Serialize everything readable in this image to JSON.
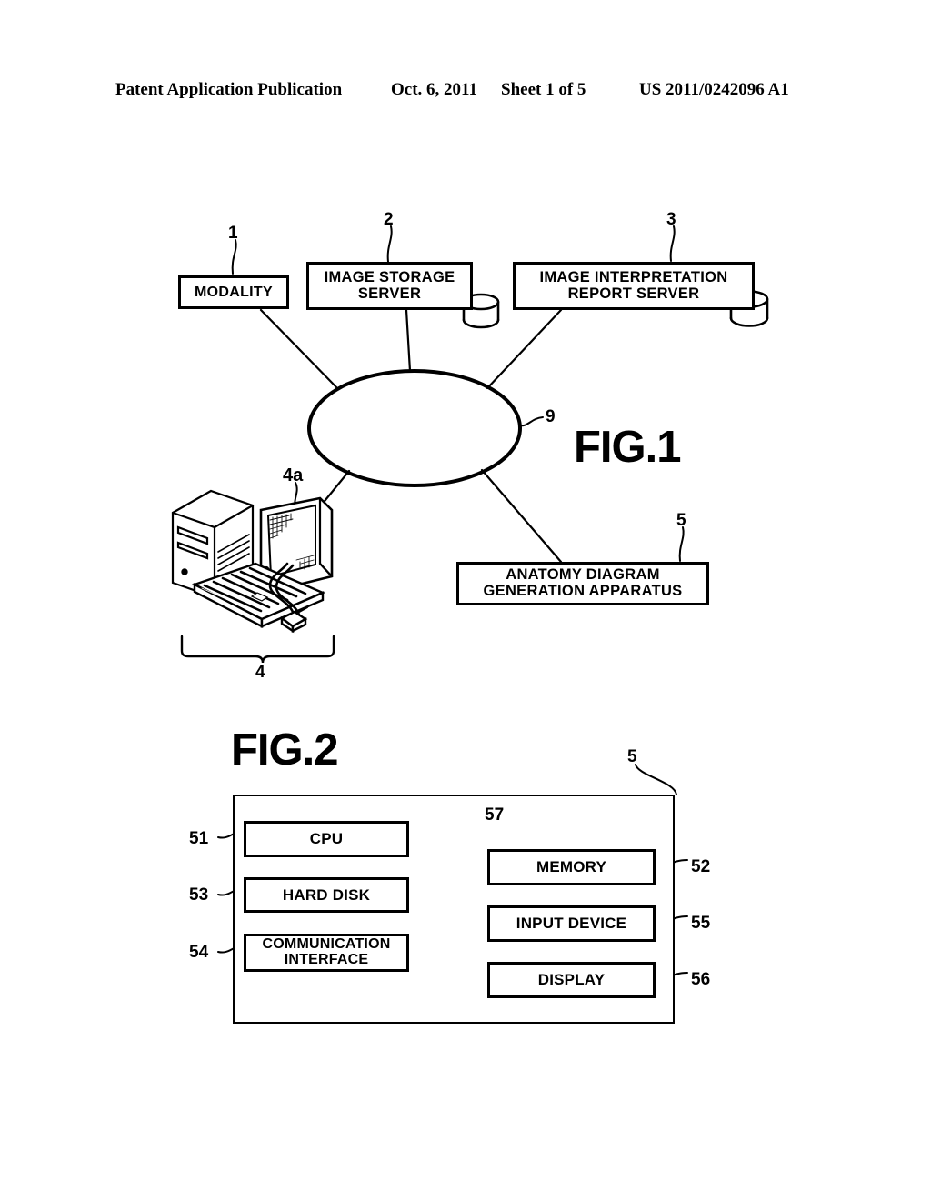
{
  "header": {
    "publication": "Patent Application Publication",
    "date": "Oct. 6, 2011",
    "sheet": "Sheet 1 of 5",
    "patent_number": "US 2011/0242096 A1"
  },
  "figure1": {
    "title": "FIG.1",
    "boxes": {
      "modality": {
        "label": "MODALITY",
        "ref": "1"
      },
      "image_storage_server": {
        "label": "IMAGE STORAGE\nSERVER",
        "line1": "IMAGE STORAGE",
        "line2": "SERVER",
        "ref": "2"
      },
      "report_server": {
        "label": "IMAGE INTERPRETATION\nREPORT SERVER",
        "line1": "IMAGE INTERPRETATION",
        "line2": "REPORT SERVER",
        "ref": "3"
      },
      "anatomy_apparatus": {
        "label": "ANATOMY DIAGRAM\nGENERATION APPARATUS",
        "line1": "ANATOMY DIAGRAM",
        "line2": "GENERATION APPARATUS",
        "ref": "5"
      }
    },
    "network": {
      "ref": "9",
      "shape": "ellipse"
    },
    "workstation": {
      "ref": "4",
      "monitor_ref": "4a"
    },
    "icons": {
      "database_storage": "database-cylinder-icon",
      "database_report": "database-cylinder-icon",
      "computer": "desktop-computer-icon",
      "monitor": "monitor-icon",
      "keyboard": "keyboard-icon",
      "mouse": "mouse-icon",
      "tower": "tower-icon"
    }
  },
  "figure2": {
    "title": "FIG.2",
    "apparatus_ref": "5",
    "bus_ref": "57",
    "left_boxes": [
      {
        "label": "CPU",
        "ref": "51"
      },
      {
        "label": "HARD DISK",
        "ref": "53"
      },
      {
        "label": "COMMUNICATION INTERFACE",
        "line1": "COMMUNICATION",
        "line2": "INTERFACE",
        "ref": "54"
      }
    ],
    "right_boxes": [
      {
        "label": "MEMORY",
        "ref": "52"
      },
      {
        "label": "INPUT DEVICE",
        "ref": "55"
      },
      {
        "label": "DISPLAY",
        "ref": "56"
      }
    ]
  },
  "colors": {
    "ink": "#000000",
    "paper": "#ffffff"
  }
}
